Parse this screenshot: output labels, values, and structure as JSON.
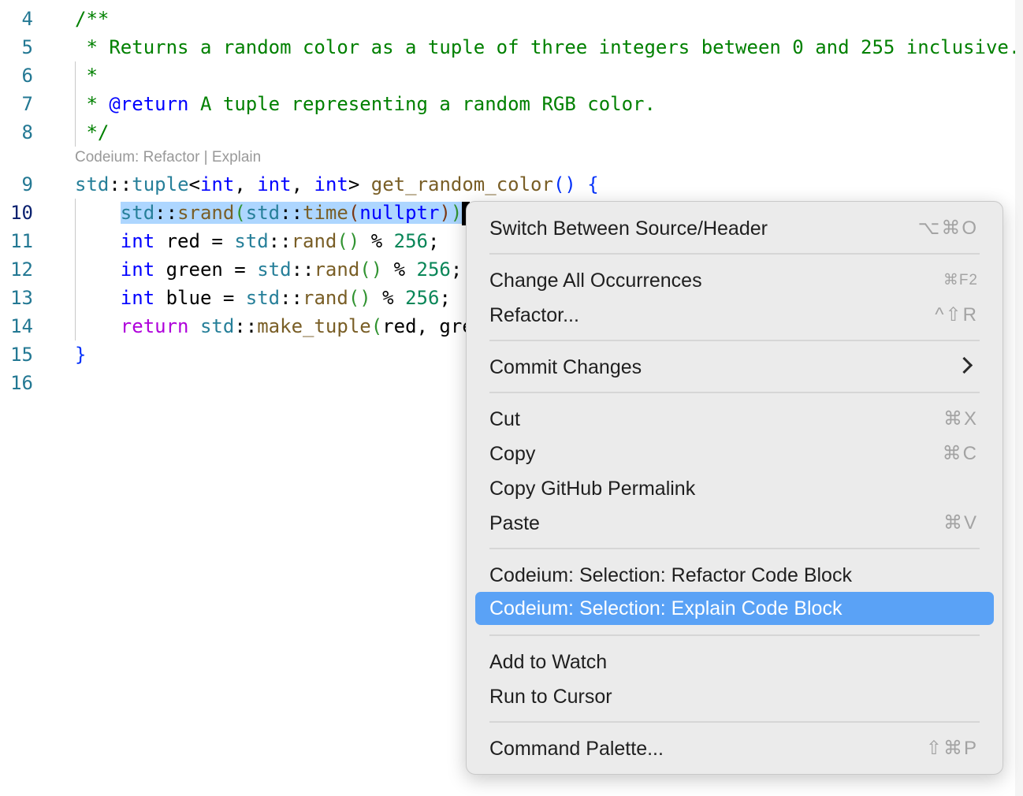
{
  "editor": {
    "lines": [
      {
        "num": "4",
        "segments": [
          {
            "t": "/**",
            "c": "c-com"
          }
        ]
      },
      {
        "num": "5",
        "segments": [
          {
            "t": " * Returns a random color as a tuple of three integers between 0 and 255 inclusive.",
            "c": "c-com"
          }
        ]
      },
      {
        "num": "6",
        "segments": [
          {
            "t": " *",
            "c": "c-com"
          }
        ]
      },
      {
        "num": "7",
        "segments": [
          {
            "t": " * ",
            "c": "c-com"
          },
          {
            "t": "@return",
            "c": "c-doc"
          },
          {
            "t": " A tuple representing a random RGB color.",
            "c": "c-com"
          }
        ]
      },
      {
        "num": "8",
        "segments": [
          {
            "t": " */",
            "c": "c-com"
          }
        ]
      },
      {
        "num": "9",
        "segments": [
          {
            "t": "std",
            "c": "c-ns"
          },
          {
            "t": "::",
            "c": "c-txt"
          },
          {
            "t": "tuple",
            "c": "c-ns"
          },
          {
            "t": "<",
            "c": "c-txt"
          },
          {
            "t": "int",
            "c": "c-kw"
          },
          {
            "t": ", ",
            "c": "c-txt"
          },
          {
            "t": "int",
            "c": "c-kw"
          },
          {
            "t": ", ",
            "c": "c-txt"
          },
          {
            "t": "int",
            "c": "c-kw"
          },
          {
            "t": "> ",
            "c": "c-txt"
          },
          {
            "t": "get_random_color",
            "c": "c-fn"
          },
          {
            "t": "() {",
            "c": "c-br1"
          }
        ]
      },
      {
        "num": "10",
        "active": true,
        "segments": [
          {
            "t": "    ",
            "c": "c-txt"
          },
          {
            "t": "std",
            "c": "c-ns sel"
          },
          {
            "t": "::",
            "c": "c-txt sel"
          },
          {
            "t": "srand",
            "c": "c-fn sel"
          },
          {
            "t": "(",
            "c": "c-br2 sel"
          },
          {
            "t": "std",
            "c": "c-ns sel"
          },
          {
            "t": "::",
            "c": "c-txt sel"
          },
          {
            "t": "time",
            "c": "c-fn sel"
          },
          {
            "t": "(",
            "c": "c-br3 sel"
          },
          {
            "t": "nullptr",
            "c": "c-kw sel"
          },
          {
            "t": ")",
            "c": "c-br3 sel"
          },
          {
            "t": ")",
            "c": "c-br2 sel"
          }
        ]
      },
      {
        "num": "11",
        "segments": [
          {
            "t": "    ",
            "c": "c-txt"
          },
          {
            "t": "int",
            "c": "c-kw"
          },
          {
            "t": " red = ",
            "c": "c-txt"
          },
          {
            "t": "std",
            "c": "c-ns"
          },
          {
            "t": "::",
            "c": "c-txt"
          },
          {
            "t": "rand",
            "c": "c-fn"
          },
          {
            "t": "()",
            "c": "c-br2"
          },
          {
            "t": " % ",
            "c": "c-txt"
          },
          {
            "t": "256",
            "c": "c-num"
          },
          {
            "t": ";",
            "c": "c-txt"
          }
        ]
      },
      {
        "num": "12",
        "segments": [
          {
            "t": "    ",
            "c": "c-txt"
          },
          {
            "t": "int",
            "c": "c-kw"
          },
          {
            "t": " green = ",
            "c": "c-txt"
          },
          {
            "t": "std",
            "c": "c-ns"
          },
          {
            "t": "::",
            "c": "c-txt"
          },
          {
            "t": "rand",
            "c": "c-fn"
          },
          {
            "t": "()",
            "c": "c-br2"
          },
          {
            "t": " % ",
            "c": "c-txt"
          },
          {
            "t": "256",
            "c": "c-num"
          },
          {
            "t": ";",
            "c": "c-txt"
          }
        ]
      },
      {
        "num": "13",
        "segments": [
          {
            "t": "    ",
            "c": "c-txt"
          },
          {
            "t": "int",
            "c": "c-kw"
          },
          {
            "t": " blue = ",
            "c": "c-txt"
          },
          {
            "t": "std",
            "c": "c-ns"
          },
          {
            "t": "::",
            "c": "c-txt"
          },
          {
            "t": "rand",
            "c": "c-fn"
          },
          {
            "t": "()",
            "c": "c-br2"
          },
          {
            "t": " % ",
            "c": "c-txt"
          },
          {
            "t": "256",
            "c": "c-num"
          },
          {
            "t": ";",
            "c": "c-txt"
          }
        ]
      },
      {
        "num": "14",
        "segments": [
          {
            "t": "    ",
            "c": "c-txt"
          },
          {
            "t": "return",
            "c": "c-ctl"
          },
          {
            "t": " ",
            "c": "c-txt"
          },
          {
            "t": "std",
            "c": "c-ns"
          },
          {
            "t": "::",
            "c": "c-txt"
          },
          {
            "t": "make_tuple",
            "c": "c-fn"
          },
          {
            "t": "(",
            "c": "c-br2"
          },
          {
            "t": "red, gre",
            "c": "c-txt"
          }
        ]
      },
      {
        "num": "15",
        "segments": [
          {
            "t": "}",
            "c": "c-br1"
          }
        ]
      },
      {
        "num": "16",
        "segments": []
      }
    ],
    "codelens": "Codeium: Refactor | Explain"
  },
  "context_menu": {
    "switch_source_header": {
      "label": "Switch Between Source/Header",
      "shortcut": "⌥⌘O"
    },
    "change_all_occurrences": {
      "label": "Change All Occurrences",
      "shortcut": "⌘F2"
    },
    "refactor": {
      "label": "Refactor...",
      "shortcut": "^⇧R"
    },
    "commit_changes": {
      "label": "Commit Changes"
    },
    "cut": {
      "label": "Cut",
      "shortcut": "⌘X"
    },
    "copy": {
      "label": "Copy",
      "shortcut": "⌘C"
    },
    "copy_github_permalink": {
      "label": "Copy GitHub Permalink"
    },
    "paste": {
      "label": "Paste",
      "shortcut": "⌘V"
    },
    "codeium_refactor": {
      "label": "Codeium: Selection: Refactor Code Block"
    },
    "codeium_explain": {
      "label": "Codeium: Selection: Explain Code Block"
    },
    "add_to_watch": {
      "label": "Add to Watch"
    },
    "run_to_cursor": {
      "label": "Run to Cursor"
    },
    "command_palette": {
      "label": "Command Palette...",
      "shortcut": "⇧⌘P"
    }
  },
  "colors": {
    "highlight": "#5aa2f6",
    "selection": "#add6ff",
    "comment": "#008000"
  }
}
